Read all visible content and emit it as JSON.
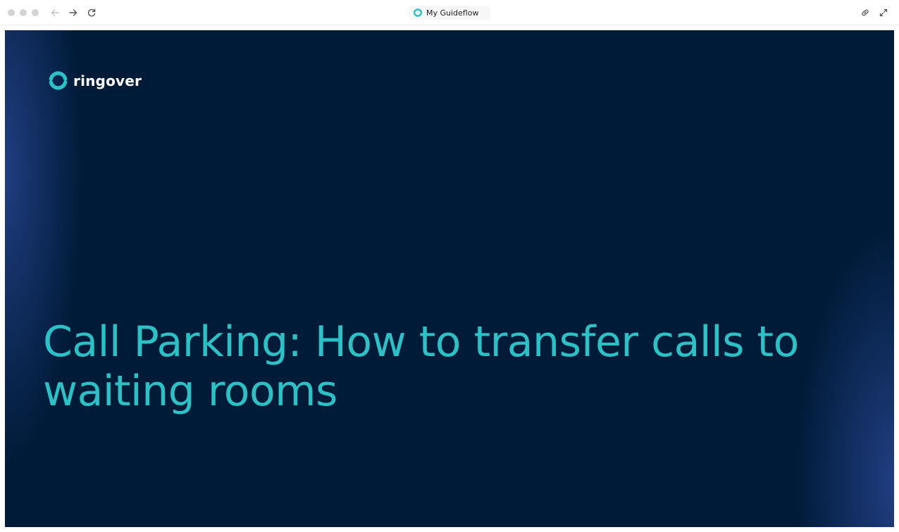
{
  "browser": {
    "tab_title": "My Guideflow",
    "icons": {
      "back": "arrow-left-icon",
      "forward": "arrow-right-icon",
      "reload": "reload-icon",
      "link": "link-icon",
      "expand": "expand-icon",
      "site": "guideflow-logo-icon"
    }
  },
  "slide": {
    "brand_name": "ringover",
    "headline": "Call Parking: How to transfer calls to waiting rooms"
  },
  "colors": {
    "slide_background": "#001b38",
    "headline": "#2ac2c7",
    "brand_logo": "#2ac2c7",
    "glow": "#3c5abe"
  }
}
